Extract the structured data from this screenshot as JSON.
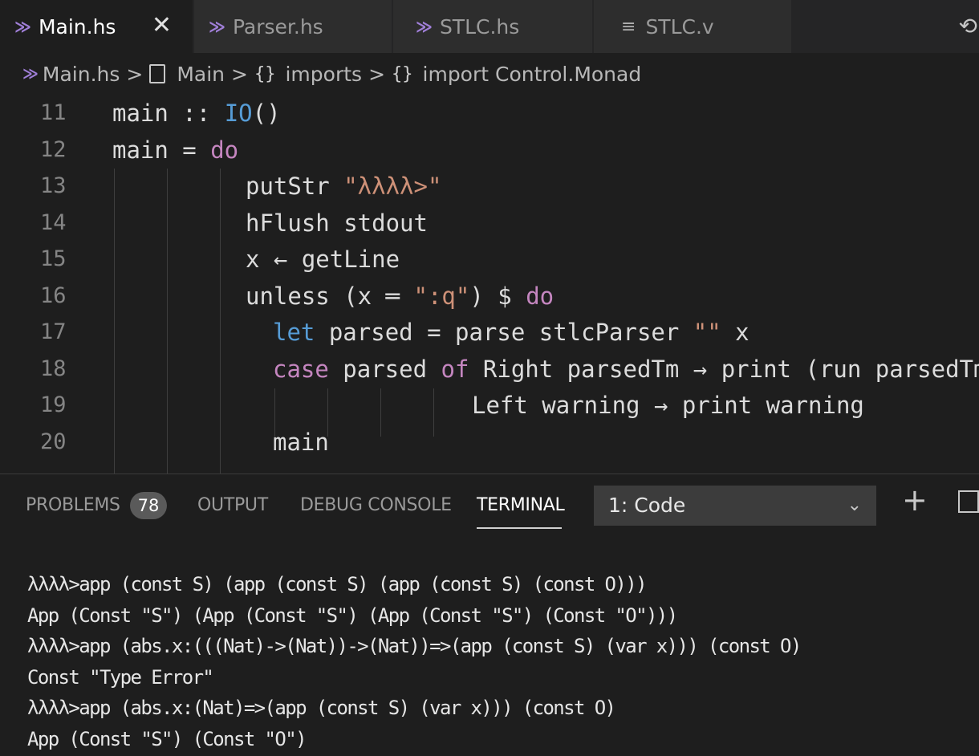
{
  "tabs": [
    {
      "label": "Main.hs",
      "icon": "haskell-icon",
      "active": true
    },
    {
      "label": "Parser.hs",
      "icon": "haskell-icon",
      "active": false
    },
    {
      "label": "STLC.hs",
      "icon": "haskell-icon",
      "active": false
    },
    {
      "label": "STLC.v",
      "icon": "lines-file-icon",
      "active": false
    }
  ],
  "tab_close_glyph": "✕",
  "breadcrumb": {
    "file": "Main.hs",
    "module": "Main",
    "section": "imports",
    "item": "import Control.Monad",
    "sep": ">"
  },
  "editor": {
    "line_numbers": [
      "11",
      "12",
      "13",
      "14",
      "15",
      "16",
      "17",
      "18",
      "19",
      "20"
    ],
    "lines": [
      {
        "tokens": [
          {
            "t": "main :: "
          },
          {
            "t": "IO",
            "c": "kw2"
          },
          {
            "t": "()"
          }
        ]
      },
      {
        "tokens": [
          {
            "t": "main = "
          },
          {
            "t": "do",
            "c": "kw"
          }
        ]
      },
      {
        "tokens": [
          {
            "t": "putStr "
          },
          {
            "t": "\"λλλλ>\"",
            "c": "str"
          }
        ]
      },
      {
        "tokens": [
          {
            "t": "hFlush stdout"
          }
        ]
      },
      {
        "tokens": [
          {
            "t": "x ← getLine"
          }
        ]
      },
      {
        "tokens": [
          {
            "t": "unless (x ═ "
          },
          {
            "t": "\":q\"",
            "c": "str"
          },
          {
            "t": ") $ "
          },
          {
            "t": "do",
            "c": "kw"
          }
        ]
      },
      {
        "tokens": [
          {
            "t": "let",
            "c": "kw2"
          },
          {
            "t": " parsed = parse stlcParser "
          },
          {
            "t": "\"\"",
            "c": "str"
          },
          {
            "t": " x"
          }
        ]
      },
      {
        "tokens": [
          {
            "t": "case",
            "c": "kw"
          },
          {
            "t": " parsed "
          },
          {
            "t": "of",
            "c": "kw"
          },
          {
            "t": " Right parsedTm → print (run parsedTm)"
          }
        ]
      },
      {
        "tokens": [
          {
            "t": "Left warning → print warning"
          }
        ]
      },
      {
        "tokens": [
          {
            "t": "main"
          }
        ]
      }
    ]
  },
  "panel": {
    "tabs": [
      "PROBLEMS",
      "OUTPUT",
      "DEBUG CONSOLE",
      "TERMINAL"
    ],
    "problems_count": "78",
    "terminal_select": "1: Code",
    "terminal_lines": [
      "λλλλ>app (const S) (app (const S) (app (const S) (const O)))",
      "App (Const \"S\") (App (Const \"S\") (App (Const \"S\") (Const \"O\")))",
      "λλλλ>app (abs.x:(((Nat)->(Nat))->(Nat))=>(app (const S) (var x))) (const O)",
      "Const \"Type Error\"",
      "λλλλ>app (abs.x:(Nat)=>(app (const S) (var x))) (const O)",
      "App (Const \"S\") (Const \"O\")"
    ]
  },
  "colors": {
    "keyword": "#c586c0",
    "keyword_blue": "#569cd6",
    "string": "#ce9178",
    "haskell_icon": "#a07fd8"
  }
}
